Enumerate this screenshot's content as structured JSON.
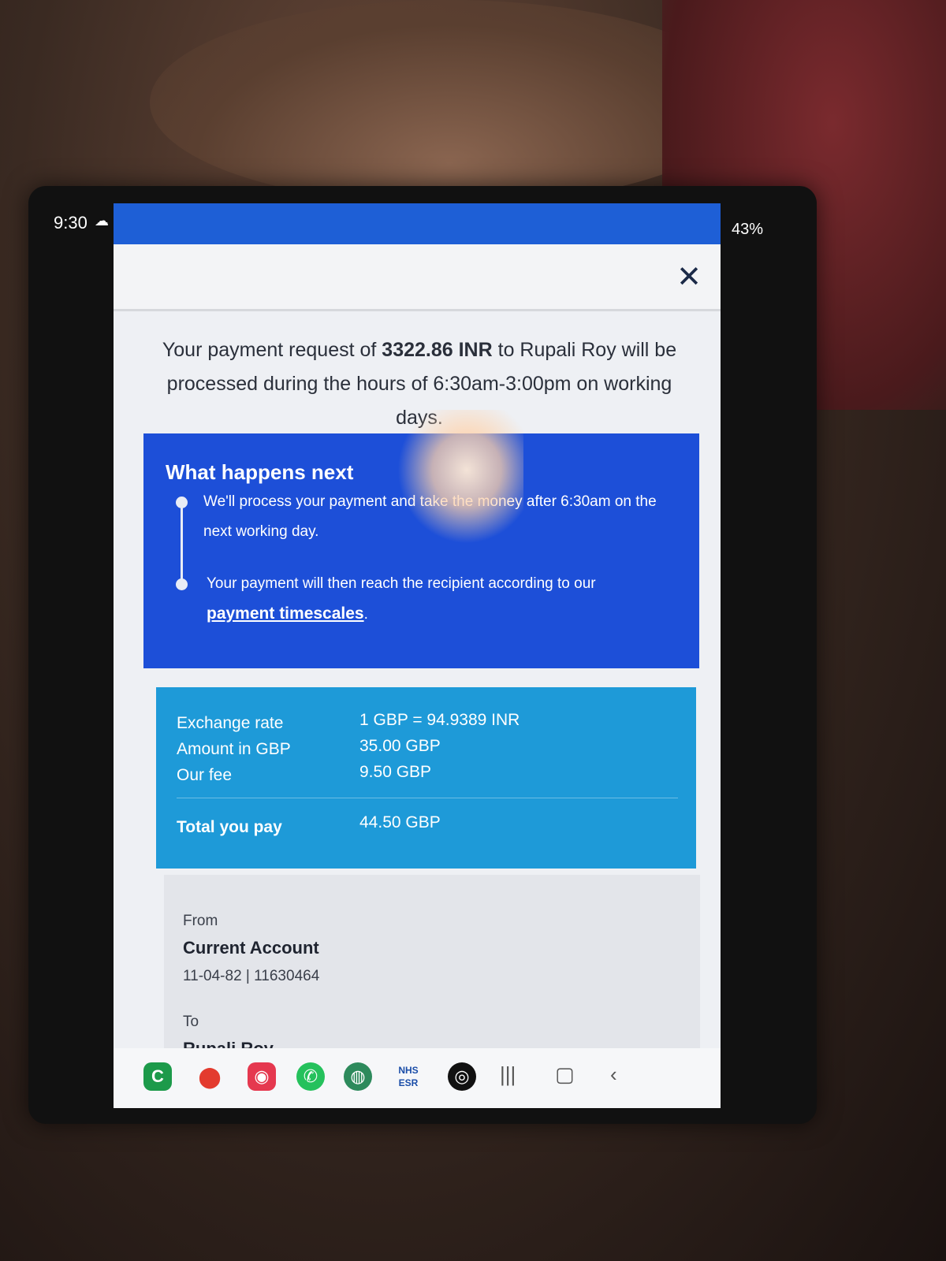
{
  "status_bar": {
    "time": "9:30",
    "battery": "43%"
  },
  "message": {
    "prefix": "Your payment request of ",
    "amount": "3322.86 INR",
    "suffix": " to Rupali Roy will be processed during the hours of 6:30am-3:00pm on working days."
  },
  "what_next": {
    "title": "What happens next",
    "step1": "We'll process your payment and take the money after 6:30am on the next working day.",
    "step2_prefix": "Your payment will then reach the recipient according to our",
    "step2_link": "payment timescales",
    "step2_suffix": "."
  },
  "summary": {
    "rows": [
      {
        "label": "Exchange rate",
        "value": "1 GBP = 94.9389 INR"
      },
      {
        "label": "Amount in GBP",
        "value": "35.00 GBP"
      },
      {
        "label": "Our fee",
        "value": "9.50 GBP"
      }
    ],
    "total_label": "Total you pay",
    "total_value": "44.50 GBP"
  },
  "from": {
    "label": "From",
    "account_name": "Current Account",
    "account_details": "11-04-82 | 11630464"
  },
  "to": {
    "label": "To",
    "name": "Rupali Roy"
  },
  "dock": {
    "esr_label": "ESR"
  },
  "colors": {
    "top_band": "#1e5fd6",
    "next_box": "#1d4fd8",
    "rate_box": "#1e9ad8",
    "account_box": "#e3e5ea"
  }
}
